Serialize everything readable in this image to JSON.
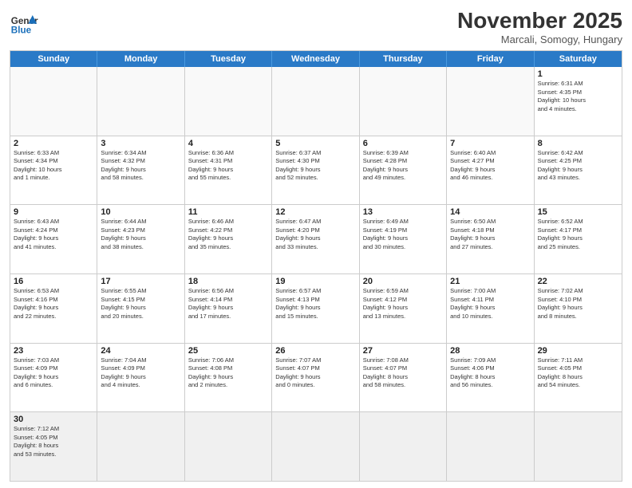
{
  "header": {
    "logo_general": "General",
    "logo_blue": "Blue",
    "month_title": "November 2025",
    "subtitle": "Marcali, Somogy, Hungary"
  },
  "weekdays": [
    "Sunday",
    "Monday",
    "Tuesday",
    "Wednesday",
    "Thursday",
    "Friday",
    "Saturday"
  ],
  "rows": [
    [
      {
        "day": "",
        "info": ""
      },
      {
        "day": "",
        "info": ""
      },
      {
        "day": "",
        "info": ""
      },
      {
        "day": "",
        "info": ""
      },
      {
        "day": "",
        "info": ""
      },
      {
        "day": "",
        "info": ""
      },
      {
        "day": "1",
        "info": "Sunrise: 6:31 AM\nSunset: 4:35 PM\nDaylight: 10 hours\nand 4 minutes."
      }
    ],
    [
      {
        "day": "2",
        "info": "Sunrise: 6:33 AM\nSunset: 4:34 PM\nDaylight: 10 hours\nand 1 minute."
      },
      {
        "day": "3",
        "info": "Sunrise: 6:34 AM\nSunset: 4:32 PM\nDaylight: 9 hours\nand 58 minutes."
      },
      {
        "day": "4",
        "info": "Sunrise: 6:36 AM\nSunset: 4:31 PM\nDaylight: 9 hours\nand 55 minutes."
      },
      {
        "day": "5",
        "info": "Sunrise: 6:37 AM\nSunset: 4:30 PM\nDaylight: 9 hours\nand 52 minutes."
      },
      {
        "day": "6",
        "info": "Sunrise: 6:39 AM\nSunset: 4:28 PM\nDaylight: 9 hours\nand 49 minutes."
      },
      {
        "day": "7",
        "info": "Sunrise: 6:40 AM\nSunset: 4:27 PM\nDaylight: 9 hours\nand 46 minutes."
      },
      {
        "day": "8",
        "info": "Sunrise: 6:42 AM\nSunset: 4:25 PM\nDaylight: 9 hours\nand 43 minutes."
      }
    ],
    [
      {
        "day": "9",
        "info": "Sunrise: 6:43 AM\nSunset: 4:24 PM\nDaylight: 9 hours\nand 41 minutes."
      },
      {
        "day": "10",
        "info": "Sunrise: 6:44 AM\nSunset: 4:23 PM\nDaylight: 9 hours\nand 38 minutes."
      },
      {
        "day": "11",
        "info": "Sunrise: 6:46 AM\nSunset: 4:22 PM\nDaylight: 9 hours\nand 35 minutes."
      },
      {
        "day": "12",
        "info": "Sunrise: 6:47 AM\nSunset: 4:20 PM\nDaylight: 9 hours\nand 33 minutes."
      },
      {
        "day": "13",
        "info": "Sunrise: 6:49 AM\nSunset: 4:19 PM\nDaylight: 9 hours\nand 30 minutes."
      },
      {
        "day": "14",
        "info": "Sunrise: 6:50 AM\nSunset: 4:18 PM\nDaylight: 9 hours\nand 27 minutes."
      },
      {
        "day": "15",
        "info": "Sunrise: 6:52 AM\nSunset: 4:17 PM\nDaylight: 9 hours\nand 25 minutes."
      }
    ],
    [
      {
        "day": "16",
        "info": "Sunrise: 6:53 AM\nSunset: 4:16 PM\nDaylight: 9 hours\nand 22 minutes."
      },
      {
        "day": "17",
        "info": "Sunrise: 6:55 AM\nSunset: 4:15 PM\nDaylight: 9 hours\nand 20 minutes."
      },
      {
        "day": "18",
        "info": "Sunrise: 6:56 AM\nSunset: 4:14 PM\nDaylight: 9 hours\nand 17 minutes."
      },
      {
        "day": "19",
        "info": "Sunrise: 6:57 AM\nSunset: 4:13 PM\nDaylight: 9 hours\nand 15 minutes."
      },
      {
        "day": "20",
        "info": "Sunrise: 6:59 AM\nSunset: 4:12 PM\nDaylight: 9 hours\nand 13 minutes."
      },
      {
        "day": "21",
        "info": "Sunrise: 7:00 AM\nSunset: 4:11 PM\nDaylight: 9 hours\nand 10 minutes."
      },
      {
        "day": "22",
        "info": "Sunrise: 7:02 AM\nSunset: 4:10 PM\nDaylight: 9 hours\nand 8 minutes."
      }
    ],
    [
      {
        "day": "23",
        "info": "Sunrise: 7:03 AM\nSunset: 4:09 PM\nDaylight: 9 hours\nand 6 minutes."
      },
      {
        "day": "24",
        "info": "Sunrise: 7:04 AM\nSunset: 4:09 PM\nDaylight: 9 hours\nand 4 minutes."
      },
      {
        "day": "25",
        "info": "Sunrise: 7:06 AM\nSunset: 4:08 PM\nDaylight: 9 hours\nand 2 minutes."
      },
      {
        "day": "26",
        "info": "Sunrise: 7:07 AM\nSunset: 4:07 PM\nDaylight: 9 hours\nand 0 minutes."
      },
      {
        "day": "27",
        "info": "Sunrise: 7:08 AM\nSunset: 4:07 PM\nDaylight: 8 hours\nand 58 minutes."
      },
      {
        "day": "28",
        "info": "Sunrise: 7:09 AM\nSunset: 4:06 PM\nDaylight: 8 hours\nand 56 minutes."
      },
      {
        "day": "29",
        "info": "Sunrise: 7:11 AM\nSunset: 4:05 PM\nDaylight: 8 hours\nand 54 minutes."
      }
    ],
    [
      {
        "day": "30",
        "info": "Sunrise: 7:12 AM\nSunset: 4:05 PM\nDaylight: 8 hours\nand 53 minutes."
      },
      {
        "day": "",
        "info": ""
      },
      {
        "day": "",
        "info": ""
      },
      {
        "day": "",
        "info": ""
      },
      {
        "day": "",
        "info": ""
      },
      {
        "day": "",
        "info": ""
      },
      {
        "day": "",
        "info": ""
      }
    ]
  ]
}
